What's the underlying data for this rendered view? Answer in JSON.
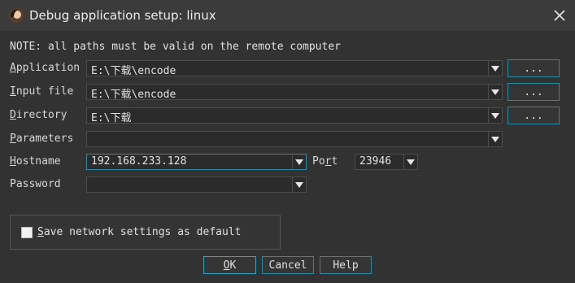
{
  "window": {
    "title": "Debug application setup: linux"
  },
  "note": "NOTE: all paths must be valid on the remote computer",
  "fields": {
    "application": {
      "label_prefix": "A",
      "label_rest": "pplication",
      "value": "E:\\下载\\encode",
      "browse_label": "..."
    },
    "input_file": {
      "label_prefix": "I",
      "label_rest": "nput file",
      "value": "E:\\下载\\encode",
      "browse_label": "..."
    },
    "directory": {
      "label_prefix": "D",
      "label_rest": "irectory",
      "value": "E:\\下载",
      "browse_label": "..."
    },
    "parameters": {
      "label_prefix": "P",
      "label_rest": "arameters",
      "value": ""
    },
    "hostname": {
      "label_prefix": "H",
      "label_rest": "ostname",
      "value": "192.168.233.128"
    },
    "port": {
      "label_a": "Po",
      "label_u": "r",
      "label_b": "t",
      "value": "23946"
    },
    "password": {
      "label": "Password",
      "value": ""
    }
  },
  "save_default": {
    "label_prefix": "S",
    "label_rest": "ave network settings as default",
    "checked": false
  },
  "buttons": {
    "ok_prefix": "O",
    "ok_rest": "K",
    "cancel": "Cancel",
    "help": "Help"
  },
  "colors": {
    "background": "#323232",
    "accent_border": "#2a8aa4"
  }
}
